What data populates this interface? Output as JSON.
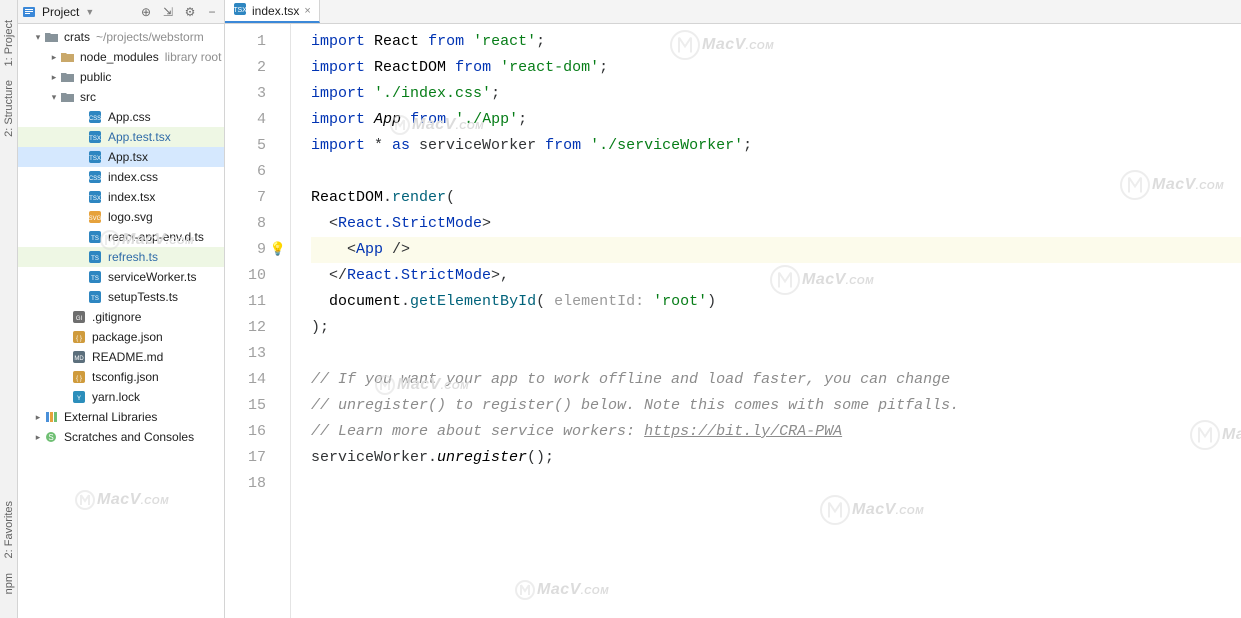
{
  "tool_strip": {
    "project": "1: Project",
    "structure": "2: Structure",
    "favorites": "2: Favorites",
    "npm": "npm"
  },
  "sidebar": {
    "label": "Project",
    "root": {
      "name": "crats",
      "path": "~/projects/webstorm"
    },
    "nodes": [
      {
        "indent": 14,
        "arrow": "down",
        "icon": "folder-root",
        "label": "crats",
        "hint": "~/projects/webstorm"
      },
      {
        "indent": 30,
        "arrow": "right",
        "icon": "folder-lib",
        "label": "node_modules",
        "hint": "library root"
      },
      {
        "indent": 30,
        "arrow": "right",
        "icon": "folder",
        "label": "public"
      },
      {
        "indent": 30,
        "arrow": "down",
        "icon": "folder",
        "label": "src"
      },
      {
        "indent": 58,
        "icon": "css",
        "label": "App.css"
      },
      {
        "indent": 58,
        "icon": "tsx",
        "label": "App.test.tsx",
        "state": "highlighted"
      },
      {
        "indent": 58,
        "icon": "tsx",
        "label": "App.tsx",
        "state": "selected"
      },
      {
        "indent": 58,
        "icon": "css",
        "label": "index.css"
      },
      {
        "indent": 58,
        "icon": "tsx",
        "label": "index.tsx"
      },
      {
        "indent": 58,
        "icon": "svg",
        "label": "logo.svg"
      },
      {
        "indent": 58,
        "icon": "ts",
        "label": "react-app-env.d.ts"
      },
      {
        "indent": 58,
        "icon": "ts",
        "label": "refresh.ts",
        "state": "highlighted"
      },
      {
        "indent": 58,
        "icon": "ts",
        "label": "serviceWorker.ts"
      },
      {
        "indent": 58,
        "icon": "ts",
        "label": "setupTests.ts"
      },
      {
        "indent": 42,
        "icon": "gitignore",
        "label": ".gitignore"
      },
      {
        "indent": 42,
        "icon": "json",
        "label": "package.json"
      },
      {
        "indent": 42,
        "icon": "md",
        "label": "README.md"
      },
      {
        "indent": 42,
        "icon": "json",
        "label": "tsconfig.json"
      },
      {
        "indent": 42,
        "icon": "yarn",
        "label": "yarn.lock"
      },
      {
        "indent": 14,
        "arrow": "right",
        "icon": "ext-lib",
        "label": "External Libraries"
      },
      {
        "indent": 14,
        "arrow": "right",
        "icon": "scratches",
        "label": "Scratches and Consoles"
      }
    ]
  },
  "tabs": [
    {
      "icon": "tsx",
      "label": "index.tsx",
      "active": true
    }
  ],
  "code": {
    "current_line": 9,
    "lines": [
      {
        "n": 1,
        "html": "<span class='kw'>import</span> <span class='cls'>React</span> <span class='kw'>from</span> <span class='str'>'react'</span>;"
      },
      {
        "n": 2,
        "html": "<span class='kw'>import</span> <span class='cls'>ReactDOM</span> <span class='kw'>from</span> <span class='str'>'react-dom'</span>;"
      },
      {
        "n": 3,
        "html": "<span class='kw'>import</span> <span class='str'>'./index.css'</span>;"
      },
      {
        "n": 4,
        "html": "<span class='kw'>import</span> <span class='method-it'>App</span> <span class='kw'>from</span> <span class='str'>'./App'</span>;"
      },
      {
        "n": 5,
        "html": "<span class='kw'>import</span> * <span class='kw'>as</span> serviceWorker <span class='kw'>from</span> <span class='str'>'./serviceWorker'</span>;"
      },
      {
        "n": 6,
        "html": ""
      },
      {
        "n": 7,
        "html": "<span class='cls'>ReactDOM</span>.<span class='fn'>render</span>("
      },
      {
        "n": 8,
        "html": "  &lt;<span class='tag'>React.StrictMode</span>&gt;"
      },
      {
        "n": 9,
        "html": "    &lt;<span class='tag'>App</span> /&gt;"
      },
      {
        "n": 10,
        "html": "  &lt;/<span class='tag'>React.StrictMode</span>&gt;,"
      },
      {
        "n": 11,
        "html": "  <span class='cls'>document</span>.<span class='fn'>getElementById</span>( <span class='attrhint'>elementId:</span> <span class='str'>'root'</span>)"
      },
      {
        "n": 12,
        "html": ");"
      },
      {
        "n": 13,
        "html": ""
      },
      {
        "n": 14,
        "html": "<span class='cmt'>// If you want your app to work offline and load faster, you can change</span>"
      },
      {
        "n": 15,
        "html": "<span class='cmt'>// unregister() to register() below. Note this comes with some pitfalls.</span>"
      },
      {
        "n": 16,
        "html": "<span class='cmt'>// Learn more about service workers: <a href='#'>https://bit.ly/CRA-PWA</a></span>"
      },
      {
        "n": 17,
        "html": "serviceWorker.<span class='method-it'>unregister</span>();"
      },
      {
        "n": 18,
        "html": ""
      }
    ]
  },
  "watermark_text": "MacV.com"
}
